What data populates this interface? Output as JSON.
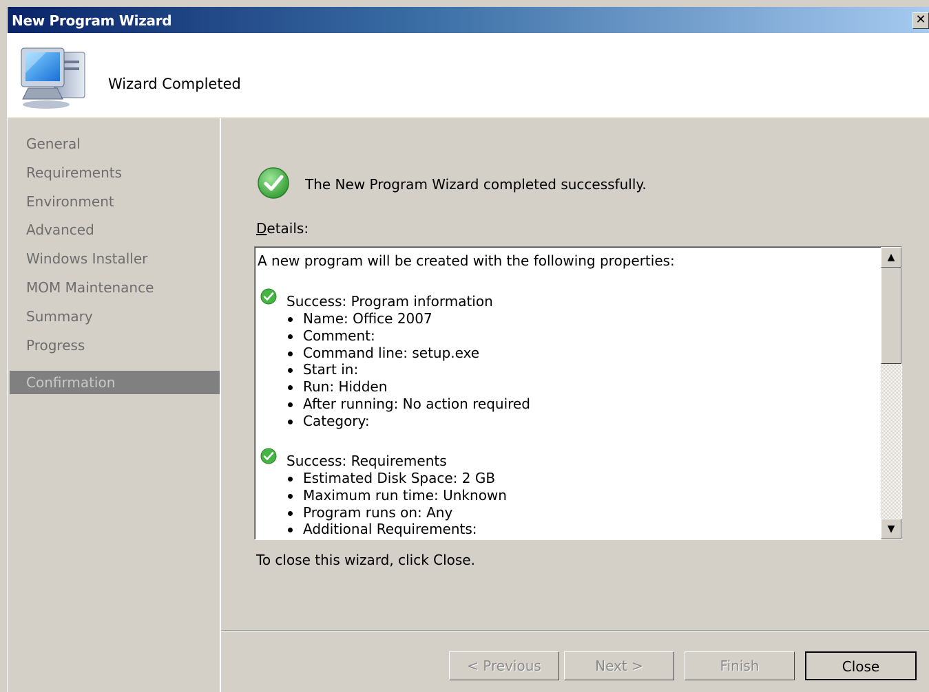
{
  "window": {
    "title": "New Program Wizard",
    "close_glyph": "✕"
  },
  "header": {
    "title": "Wizard Completed",
    "icon": "computer-setup-icon"
  },
  "sidebar": {
    "items": [
      {
        "label": "General"
      },
      {
        "label": "Requirements"
      },
      {
        "label": "Environment"
      },
      {
        "label": "Advanced"
      },
      {
        "label": "Windows Installer"
      },
      {
        "label": "MOM Maintenance"
      },
      {
        "label": "Summary"
      },
      {
        "label": "Progress"
      },
      {
        "label": "Confirmation",
        "active": true
      }
    ]
  },
  "main": {
    "status_message": "The New Program Wizard completed successfully.",
    "details_label_accel": "D",
    "details_label_rest": "etails:",
    "details": {
      "intro": "A new program will be created with the following properties:",
      "sections": [
        {
          "title": "Success: Program information",
          "items": [
            "Name: Office 2007",
            "Comment:",
            "Command line: setup.exe",
            "Start in:",
            "Run: Hidden",
            "After running: No action required",
            "Category:"
          ]
        },
        {
          "title": "Success: Requirements",
          "items": [
            "Estimated Disk Space: 2 GB",
            "Maximum run time: Unknown",
            "Program runs on: Any",
            "Additional Requirements:"
          ]
        }
      ]
    },
    "close_hint": "To close this wizard, click Close."
  },
  "buttons": {
    "previous": {
      "label": "< Previous",
      "enabled": false
    },
    "next": {
      "label": "Next >",
      "enabled": false
    },
    "finish": {
      "label": "Finish",
      "enabled": false
    },
    "close": {
      "label": "Close",
      "enabled": true
    }
  },
  "colors": {
    "success_green": "#3cae3a",
    "face": "#d4d0c8",
    "active_item": "#808080"
  }
}
